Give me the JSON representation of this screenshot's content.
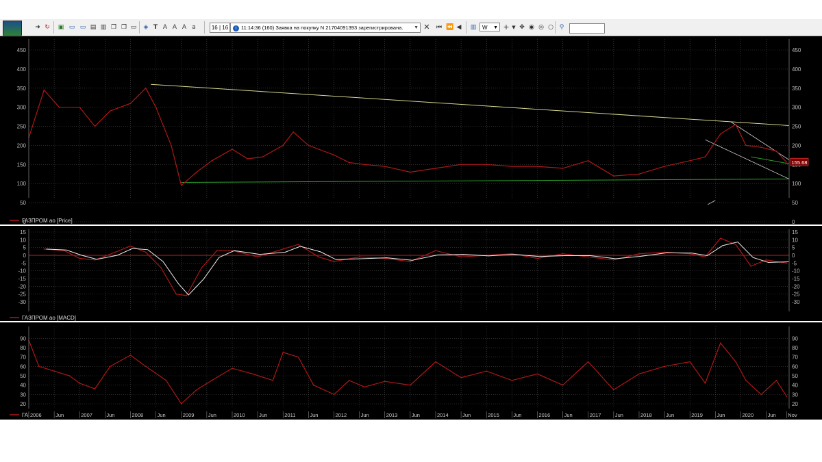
{
  "toolbar": {
    "counter": "16 | 16",
    "message": "11:14:36  (160) Заявка на покупку N 21704091393 зарегистрирована.",
    "interval": "W",
    "search_value": "",
    "icons": [
      "logo-icon",
      "arrow-right-icon",
      "refresh-icon",
      "new-chart-icon",
      "window-icon",
      "window-icon",
      "print-icon",
      "print-preview-icon",
      "copy-icon",
      "hint-icon",
      "text-tool-icon",
      "font-icon",
      "font-size-icon",
      "font-color-icon",
      "close-icon",
      "first-page-icon",
      "prev-icon",
      "bar-chart-icon",
      "crosshair-icon",
      "move-icon",
      "target-icon",
      "zoom-icon"
    ]
  },
  "panels": {
    "price": {
      "label": "ГАЗПРОМ ао [Price]",
      "ticks": [
        "450",
        "400",
        "350",
        "300",
        "250",
        "200",
        "150",
        "100",
        "50",
        "0"
      ],
      "last_price": "155.68"
    },
    "macd": {
      "label": "ГАЗПРОМ ао [MACD]",
      "ticks": [
        "15",
        "10",
        "5",
        "0",
        "-5",
        "-10",
        "-15",
        "-20",
        "-25",
        "-30"
      ]
    },
    "rsi": {
      "label": "ГАЗПРОМ ао [RSI]",
      "ticks": [
        "90",
        "80",
        "70",
        "60",
        "50",
        "40",
        "30",
        "20"
      ]
    }
  },
  "time_axis": [
    "2006",
    "Jun",
    "2007",
    "Jun",
    "2008",
    "Jun",
    "2009",
    "Jun",
    "2010",
    "Jun",
    "2011",
    "Jun",
    "2012",
    "Jun",
    "2013",
    "Jun",
    "2014",
    "Jun",
    "2015",
    "Jun",
    "2016",
    "Jun",
    "2017",
    "Jun",
    "2018",
    "Jun",
    "2019",
    "Jun",
    "2020",
    "Jun",
    "Nov"
  ],
  "colors": {
    "background": "#000000",
    "price_line": "#b01818",
    "trendline": "#d8d890",
    "support": "#2aa02a",
    "panel_separator": "#ffffff",
    "grid": "#4a4a4a"
  },
  "chart_data": [
    {
      "type": "line",
      "title": "ГАЗПРОМ ао [Price]",
      "x": [
        2006.0,
        2006.3,
        2006.6,
        2007.0,
        2007.3,
        2007.6,
        2008.0,
        2008.3,
        2008.5,
        2008.8,
        2009.0,
        2009.3,
        2009.6,
        2010.0,
        2010.3,
        2010.6,
        2011.0,
        2011.2,
        2011.5,
        2012.0,
        2012.3,
        2012.6,
        2013.0,
        2013.5,
        2014.0,
        2014.5,
        2015.0,
        2015.5,
        2016.0,
        2016.5,
        2017.0,
        2017.5,
        2018.0,
        2018.5,
        2019.0,
        2019.3,
        2019.6,
        2019.9,
        2020.1,
        2020.4,
        2020.7,
        2020.9
      ],
      "y": [
        220,
        345,
        300,
        300,
        250,
        290,
        310,
        350,
        300,
        200,
        95,
        130,
        160,
        190,
        165,
        170,
        200,
        235,
        200,
        175,
        155,
        150,
        145,
        130,
        140,
        150,
        150,
        145,
        145,
        140,
        160,
        120,
        125,
        145,
        160,
        170,
        230,
        255,
        200,
        195,
        185,
        156
      ],
      "ylim": [
        0,
        460
      ]
    },
    {
      "type": "line",
      "title": "ГАЗПРОМ ао [MACD]",
      "x": [
        2006.3,
        2006.7,
        2007.0,
        2007.3,
        2007.7,
        2008.0,
        2008.3,
        2008.6,
        2008.9,
        2009.1,
        2009.4,
        2009.7,
        2010.0,
        2010.5,
        2011.0,
        2011.3,
        2011.7,
        2012.0,
        2012.5,
        2013.0,
        2013.5,
        2014.0,
        2014.5,
        2015.0,
        2015.5,
        2016.0,
        2016.5,
        2017.0,
        2017.5,
        2018.0,
        2018.5,
        2019.0,
        2019.3,
        2019.6,
        2019.9,
        2020.2,
        2020.5,
        2020.9
      ],
      "y": [
        4,
        3,
        -2,
        -3,
        2,
        6,
        2,
        -8,
        -25,
        -26,
        -8,
        3,
        3,
        -1,
        4,
        7,
        -1,
        -4,
        -1,
        -2,
        -4,
        3,
        -1,
        0,
        1,
        -2,
        1,
        -1,
        -3,
        1,
        2,
        1,
        -1,
        11,
        7,
        -7,
        -3,
        -5
      ],
      "ylim": [
        -30,
        16
      ]
    },
    {
      "type": "line",
      "title": "ГАЗПРОМ ао [RSI]",
      "x": [
        2006.0,
        2006.2,
        2006.5,
        2006.8,
        2007.0,
        2007.3,
        2007.6,
        2008.0,
        2008.3,
        2008.7,
        2009.0,
        2009.3,
        2009.6,
        2010.0,
        2010.4,
        2010.8,
        2011.0,
        2011.3,
        2011.6,
        2012.0,
        2012.3,
        2012.6,
        2013.0,
        2013.5,
        2014.0,
        2014.5,
        2015.0,
        2015.5,
        2016.0,
        2016.5,
        2017.0,
        2017.5,
        2018.0,
        2018.5,
        2019.0,
        2019.3,
        2019.6,
        2019.9,
        2020.1,
        2020.4,
        2020.7,
        2020.9
      ],
      "y": [
        88,
        60,
        55,
        50,
        42,
        36,
        60,
        72,
        60,
        45,
        20,
        35,
        45,
        58,
        52,
        45,
        75,
        70,
        40,
        30,
        45,
        38,
        44,
        40,
        65,
        48,
        55,
        45,
        52,
        40,
        65,
        35,
        52,
        60,
        65,
        42,
        85,
        65,
        45,
        30,
        45,
        28
      ],
      "ylim": [
        15,
        95
      ]
    }
  ]
}
